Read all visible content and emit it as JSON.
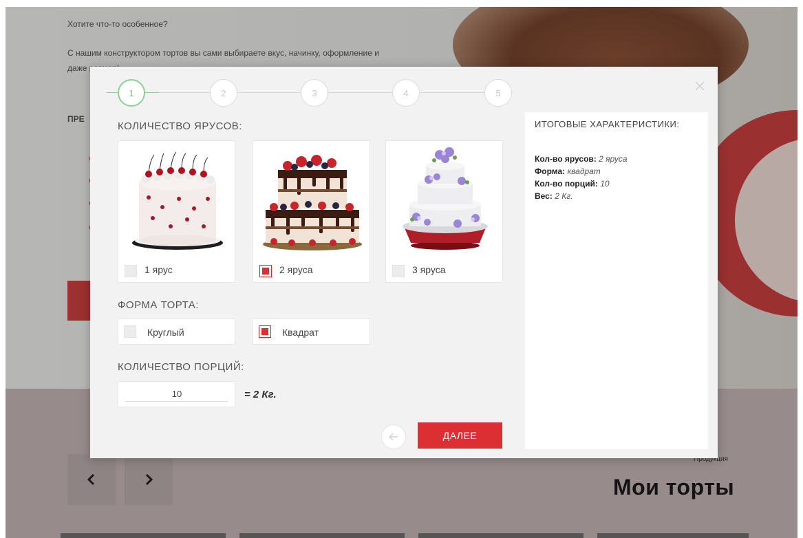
{
  "background": {
    "hero_heading": "Хотите что-то особенное?",
    "hero_text": "С нашим конструктором тортов вы сами выбираете вкус, начинку, оформление и даже размер!",
    "section_label": "ПРЕ",
    "small_label": "Продукция",
    "title": "Мои торты"
  },
  "modal": {
    "steps": [
      "1",
      "2",
      "3",
      "4",
      "5"
    ],
    "active_step": 1,
    "tiers": {
      "label": "КОЛИЧЕСТВО ЯРУСОВ:",
      "options": [
        {
          "label": "1 ярус",
          "checked": false
        },
        {
          "label": "2 яруса",
          "checked": true
        },
        {
          "label": "3 яруса",
          "checked": false
        }
      ]
    },
    "shape": {
      "label": "ФОРМА ТОРТА:",
      "options": [
        {
          "label": "Круглый",
          "checked": false
        },
        {
          "label": "Квадрат",
          "checked": true
        }
      ]
    },
    "portions": {
      "label": "КОЛИЧЕСТВО ПОРЦИЙ:",
      "value": "10",
      "weight": "= 2 Кг."
    },
    "next_label": "ДАЛЕЕ",
    "summary": {
      "title": "ИТОГОВЫЕ ХАРАКТЕРИСТИКИ:",
      "rows": [
        {
          "key": "Кол-во ярусов:",
          "value": "2 яруса"
        },
        {
          "key": "Форма:",
          "value": "квадрат"
        },
        {
          "key": "Кол-во порций:",
          "value": "10"
        },
        {
          "key": "Вес:",
          "value": "2 Кг."
        }
      ]
    }
  },
  "colors": {
    "accent_red": "#dc2f34",
    "step_active_green": "#8ecf96"
  },
  "icons": {
    "close": "close-icon",
    "back": "arrow-left-icon",
    "carousel_prev": "chevron-left-icon",
    "carousel_next": "chevron-right-icon"
  }
}
